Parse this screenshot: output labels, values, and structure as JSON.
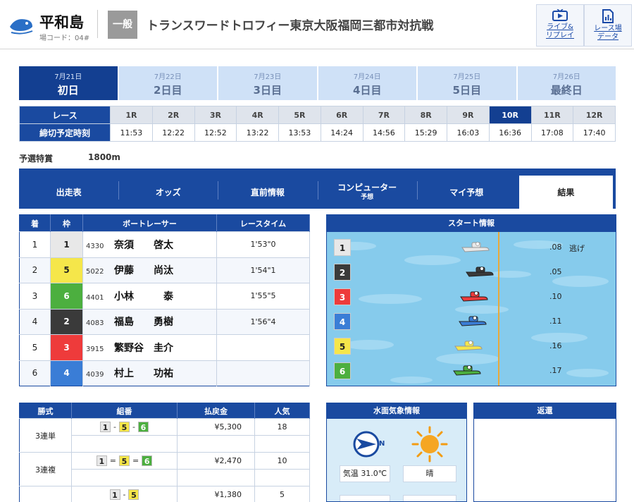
{
  "header": {
    "venue": "平和島",
    "venue_code": "場コード：04#",
    "grade": "一般",
    "race_title": "トランスワードトロフィー東京大阪福岡三都市対抗戦",
    "live_label_1": "ライブ&",
    "live_label_2": "リプレイ",
    "data_label_1": "レース場",
    "data_label_2": "データ"
  },
  "dates": [
    {
      "date": "7月21日",
      "name": "初日",
      "active": true
    },
    {
      "date": "7月22日",
      "name": "2日目",
      "active": false
    },
    {
      "date": "7月23日",
      "name": "3日目",
      "active": false
    },
    {
      "date": "7月24日",
      "name": "4日目",
      "active": false
    },
    {
      "date": "7月25日",
      "name": "5日目",
      "active": false
    },
    {
      "date": "7月26日",
      "name": "最終日",
      "active": false
    }
  ],
  "race_table": {
    "race_label": "レース",
    "deadline_label": "締切予定時刻",
    "races": [
      "1R",
      "2R",
      "3R",
      "4R",
      "5R",
      "6R",
      "7R",
      "8R",
      "9R",
      "10R",
      "11R",
      "12R"
    ],
    "times": [
      "11:53",
      "12:22",
      "12:52",
      "13:22",
      "13:53",
      "14:24",
      "14:56",
      "15:29",
      "16:03",
      "16:36",
      "17:08",
      "17:40"
    ],
    "selected": "10R"
  },
  "race_info": {
    "name": "予選特賞",
    "distance": "1800m"
  },
  "nav_tabs": [
    {
      "label": "出走表",
      "sub": ""
    },
    {
      "label": "オッズ",
      "sub": ""
    },
    {
      "label": "直前情報",
      "sub": ""
    },
    {
      "label": "コンピューター",
      "sub": "予想"
    },
    {
      "label": "マイ予想",
      "sub": ""
    },
    {
      "label": "結果",
      "sub": "",
      "active": true
    }
  ],
  "results": {
    "headers": [
      "着",
      "枠",
      "ボートレーサー",
      "レースタイム"
    ],
    "rows": [
      {
        "place": "1",
        "frame": "1",
        "reg": "4330",
        "name": "奈須　　啓太",
        "time": "1'53\"0"
      },
      {
        "place": "2",
        "frame": "5",
        "reg": "5022",
        "name": "伊藤　　尚汰",
        "time": "1'54\"1"
      },
      {
        "place": "3",
        "frame": "6",
        "reg": "4401",
        "name": "小林　　　泰",
        "time": "1'55\"5"
      },
      {
        "place": "4",
        "frame": "2",
        "reg": "4083",
        "name": "福島　　勇樹",
        "time": "1'56\"4"
      },
      {
        "place": "5",
        "frame": "3",
        "reg": "3915",
        "name": "繁野谷　圭介",
        "time": ""
      },
      {
        "place": "6",
        "frame": "4",
        "reg": "4039",
        "name": "村上　　功祐",
        "time": ""
      }
    ]
  },
  "start_info": {
    "title": "スタート情報",
    "rows": [
      {
        "boat": "1",
        "st": ".08",
        "kimarite": "逃げ",
        "color": "#e8e8e8"
      },
      {
        "boat": "2",
        "st": ".05",
        "kimarite": "",
        "color": "#3a3a3a"
      },
      {
        "boat": "3",
        "st": ".10",
        "kimarite": "",
        "color": "#ee3b3b"
      },
      {
        "boat": "4",
        "st": ".11",
        "kimarite": "",
        "color": "#3a7dd6"
      },
      {
        "boat": "5",
        "st": ".16",
        "kimarite": "",
        "color": "#f5e64a"
      },
      {
        "boat": "6",
        "st": ".17",
        "kimarite": "",
        "color": "#4caf3f"
      }
    ]
  },
  "payout": {
    "headers": [
      "勝式",
      "組番",
      "払戻金",
      "人気"
    ],
    "rows": [
      {
        "bet": "3連単",
        "combo": [
          "1",
          "5",
          "6"
        ],
        "sep": "-",
        "amount": "¥5,300",
        "pop": "18"
      },
      {
        "bet": "3連複",
        "combo": [
          "1",
          "5",
          "6"
        ],
        "sep": "=",
        "amount": "¥2,470",
        "pop": "10"
      },
      {
        "bet": "",
        "combo": [
          "1",
          "5"
        ],
        "sep": "-",
        "amount": "¥1,380",
        "pop": "5"
      }
    ]
  },
  "weather": {
    "title": "水面気象情報",
    "wind_dir": "N",
    "temp_label": "気温",
    "temp": "31.0℃",
    "condition": "晴"
  },
  "refund": {
    "title": "返還"
  }
}
